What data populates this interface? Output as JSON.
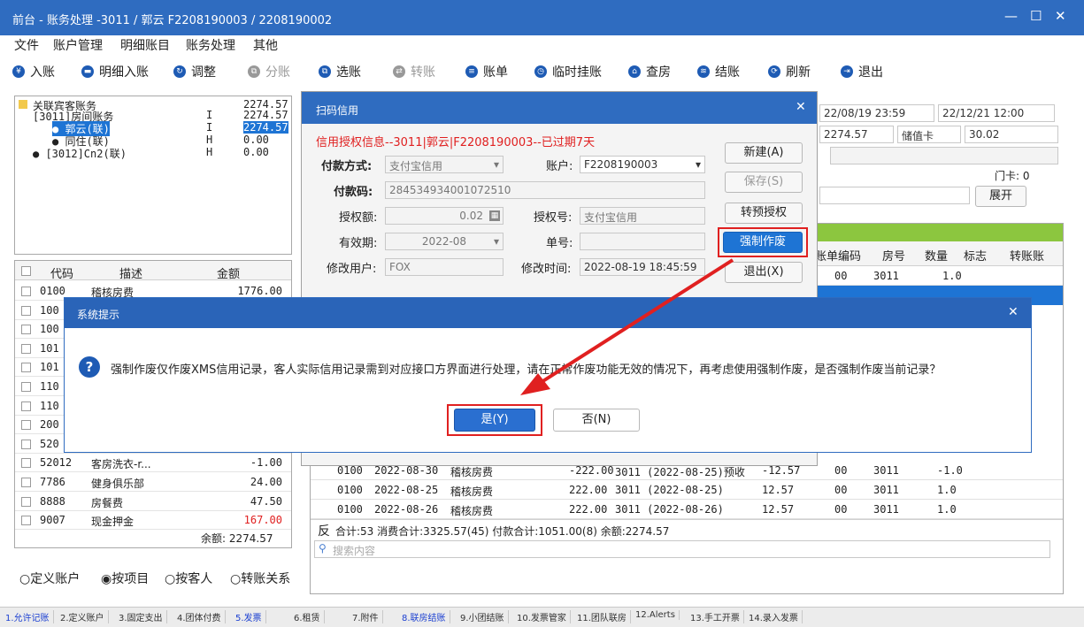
{
  "window": {
    "title": "前台 - 账务处理 -3011 / 郭云 F2208190003 / 2208190002",
    "min": "—",
    "max": "☐",
    "close": "✕"
  },
  "menu": [
    "文件",
    "账户管理",
    "明细账目",
    "账务处理",
    "其他"
  ],
  "toolbar": [
    {
      "label": "入账",
      "icon": "yen-icon",
      "glyph": "¥",
      "enabled": true
    },
    {
      "label": "明细入账",
      "icon": "card-icon",
      "glyph": "▬",
      "enabled": true
    },
    {
      "label": "调整",
      "icon": "adjust-icon",
      "glyph": "↻",
      "enabled": true
    },
    {
      "label": "分账",
      "icon": "split-icon",
      "glyph": "⧉",
      "enabled": false
    },
    {
      "label": "选账",
      "icon": "select-icon",
      "glyph": "⧉",
      "enabled": true
    },
    {
      "label": "转账",
      "icon": "transfer-icon",
      "glyph": "⇄",
      "enabled": false
    },
    {
      "label": "账单",
      "icon": "bill-icon",
      "glyph": "≡",
      "enabled": true
    },
    {
      "label": "临时挂账",
      "icon": "clock-icon",
      "glyph": "◷",
      "enabled": true
    },
    {
      "label": "查房",
      "icon": "house-icon",
      "glyph": "⌂",
      "enabled": true
    },
    {
      "label": "结账",
      "icon": "database-icon",
      "glyph": "≋",
      "enabled": true
    },
    {
      "label": "刷新",
      "icon": "refresh-icon",
      "glyph": "⟳",
      "enabled": true
    },
    {
      "label": "退出",
      "icon": "exit-icon",
      "glyph": "⇥",
      "enabled": true
    }
  ],
  "tree": {
    "root": {
      "label": "关联宾客账务",
      "amount": "2274.57"
    },
    "nodes": [
      {
        "label": "[3011]房间账务",
        "flag": "I",
        "amount": "2274.57",
        "selected": false
      },
      {
        "label": "● 郭云(联)",
        "flag": "I",
        "amount": "2274.57",
        "selected": true
      },
      {
        "label": "● 同住(联)",
        "flag": "H",
        "amount": "0.00",
        "selected": false
      },
      {
        "label": "● [3012]Cn2(联)",
        "flag": "H",
        "amount": "0.00",
        "selected": false
      }
    ]
  },
  "left_table": {
    "headers": [
      "代码",
      "描述",
      "金额"
    ],
    "rows": [
      {
        "code": "0100",
        "desc": "稽核房费",
        "amount": "1776.00",
        "red": false
      },
      {
        "code": "100",
        "desc": "",
        "amount": "",
        "red": false
      },
      {
        "code": "100",
        "desc": "",
        "amount": "",
        "red": false
      },
      {
        "code": "101",
        "desc": "",
        "amount": "",
        "red": false
      },
      {
        "code": "101",
        "desc": "",
        "amount": "",
        "red": false
      },
      {
        "code": "110",
        "desc": "",
        "amount": "",
        "red": false
      },
      {
        "code": "110",
        "desc": "",
        "amount": "",
        "red": false
      },
      {
        "code": "200",
        "desc": "",
        "amount": "",
        "red": false
      },
      {
        "code": "520",
        "desc": "",
        "amount": "",
        "red": false
      },
      {
        "code": "52012",
        "desc": "客房洗衣-r...",
        "amount": "-1.00",
        "red": false
      },
      {
        "code": "7786",
        "desc": "健身俱乐部",
        "amount": "24.00",
        "red": false
      },
      {
        "code": "8888",
        "desc": "房餐费",
        "amount": "47.50",
        "red": false
      },
      {
        "code": "9007",
        "desc": "现金押金",
        "amount": "167.00",
        "red": true
      }
    ],
    "balance": "余额: 2274.57"
  },
  "radios": [
    {
      "label": "定义账户",
      "checked": false
    },
    {
      "label": "按项目",
      "checked": true
    },
    {
      "label": "按客人",
      "checked": false
    },
    {
      "label": "转账关系",
      "checked": false
    }
  ],
  "right_info": {
    "arrive": "22/08/19 23:59",
    "depart": "22/12/21 12:00",
    "balance": "2274.57",
    "card_type": "储值卡",
    "card_value": "30.02",
    "door_card": "门卡: 0",
    "expand_btn": "展开"
  },
  "right_table": {
    "headers": [
      "账单编码",
      "房号",
      "数量",
      "标志",
      "转账账"
    ],
    "top_row": {
      "bill": "00",
      "room": "3011",
      "qty": "1.0"
    },
    "rows": [
      {
        "code": "0100",
        "date": "2022-08-30",
        "desc": "稽核房费",
        "amount": "-222.00",
        "note": "3011 (2022-08-25)预收",
        "num": "-12.57",
        "bill": "00",
        "room": "3011",
        "qty": "-1.0"
      },
      {
        "code": "0100",
        "date": "2022-08-25",
        "desc": "稽核房费",
        "amount": "222.00",
        "note": "3011 (2022-08-25)",
        "num": "12.57",
        "bill": "00",
        "room": "3011",
        "qty": "1.0"
      },
      {
        "code": "0100",
        "date": "2022-08-26",
        "desc": "稽核房费",
        "amount": "222.00",
        "note": "3011 (2022-08-26)",
        "num": "12.57",
        "bill": "00",
        "room": "3011",
        "qty": "1.0"
      }
    ],
    "summary_prefix": "反",
    "summary": "合计:53  消费合计:3325.57(45)  付款合计:1051.00(8)  余额:2274.57",
    "search_placeholder": "搜索内容"
  },
  "scan_dialog": {
    "title": "扫码信用",
    "close": "✕",
    "info": "信用授权信息--3011|郭云|F2208190003--已过期7天",
    "pay_method_label": "付款方式:",
    "pay_method": "支付宝信用",
    "account_label": "账户:",
    "account": "F2208190003",
    "pay_code_label": "付款码:",
    "pay_code": "284534934001072510",
    "auth_amount_label": "授权额:",
    "auth_amount": "0.02",
    "auth_no_label": "授权号:",
    "auth_no": "支付宝信用",
    "valid_label": "有效期:",
    "valid": "2022-08",
    "order_label": "单号:",
    "order": "",
    "user_label": "修改用户:",
    "user": "FOX",
    "mtime_label": "修改时间:",
    "mtime": "2022-08-19 18:45:59",
    "btn_new": "新建(A)",
    "btn_save": "保存(S)",
    "btn_pre": "转预授权",
    "btn_force": "强制作废",
    "btn_exit": "退出(X)"
  },
  "prompt": {
    "title": "系统提示",
    "close": "✕",
    "message": "强制作废仅作废XMS信用记录，客人实际信用记录需到对应接口方界面进行处理，请在正常作废功能无效的情况下，再考虑使用强制作废，是否强制作废当前记录？",
    "yes": "是(Y)",
    "no": "否(N)"
  },
  "bottom_tabs": [
    {
      "label": "1.允许记账",
      "blue": true
    },
    {
      "label": "2.定义账户",
      "blue": false
    },
    {
      "label": "3.固定支出",
      "blue": false
    },
    {
      "label": "4.团体付费",
      "blue": false
    },
    {
      "label": "5.发票",
      "blue": true
    },
    {
      "label": "6.租赁",
      "blue": false
    },
    {
      "label": "7.附件",
      "blue": false
    },
    {
      "label": "8.联房结账",
      "blue": true
    },
    {
      "label": "9.小团结账",
      "blue": false
    },
    {
      "label": "10.发票管家",
      "blue": false
    },
    {
      "label": "11.团队联房",
      "blue": false
    },
    {
      "label": "12.Alerts",
      "blue": false
    },
    {
      "label": "13.手工开票",
      "blue": false
    },
    {
      "label": "14.录入发票",
      "blue": false
    }
  ],
  "colors": {
    "title_bar": "#2f6cc0",
    "accent_green": "#8cc63f",
    "highlight_red": "#e02020",
    "selected_blue": "#1e74d4"
  }
}
